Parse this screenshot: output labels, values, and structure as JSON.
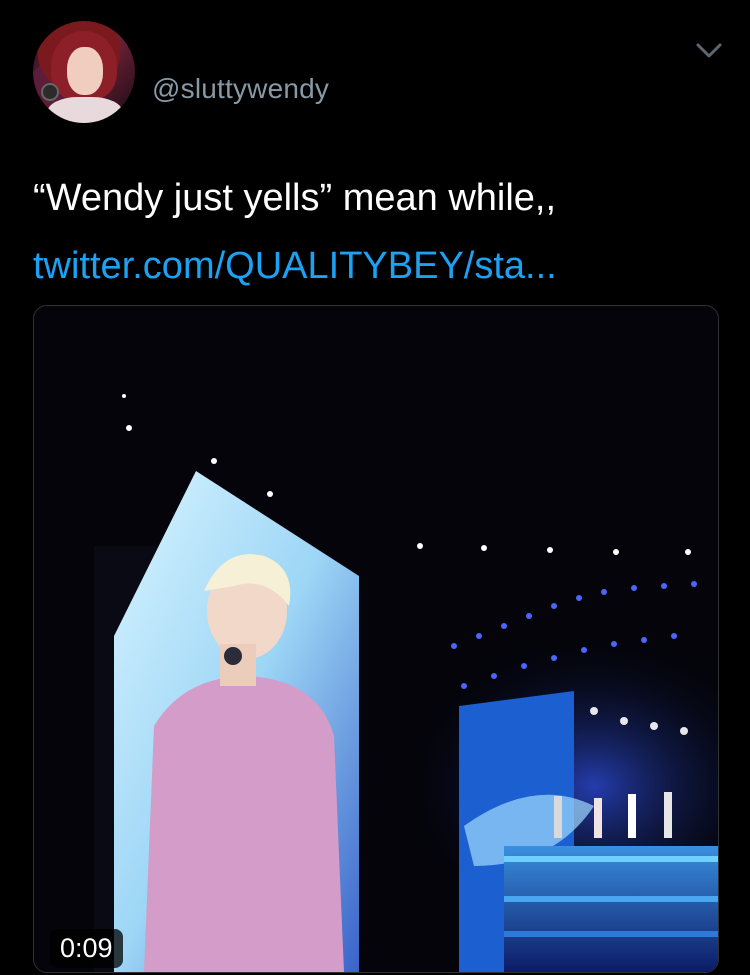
{
  "tweet": {
    "handle": "@sluttywendy",
    "text": "“Wendy just yells” mean while,,",
    "link": "twitter.com/QUALITYBEY/sta...",
    "menu_icon": "chevron-down-icon"
  },
  "media": {
    "duration": "0:09",
    "type": "video"
  },
  "colors": {
    "background": "#000000",
    "link": "#1da1f2",
    "handle": "#8899a6",
    "text": "#ffffff"
  }
}
